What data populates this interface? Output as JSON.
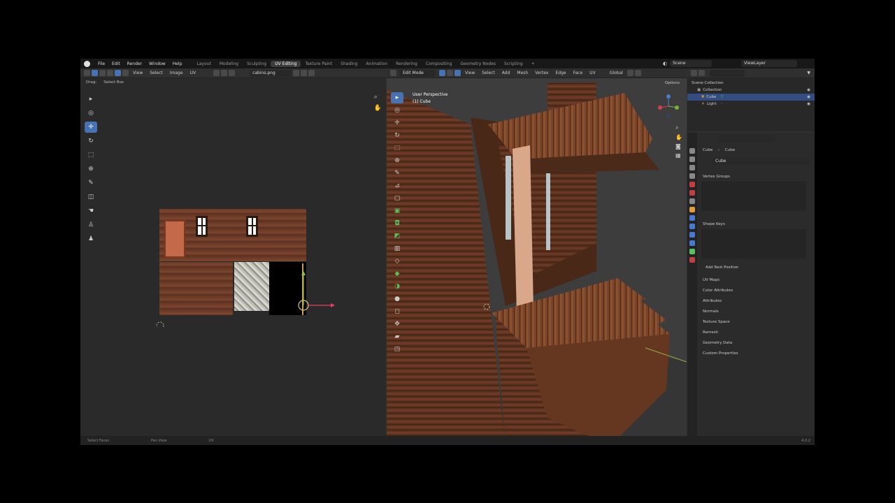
{
  "menu": [
    "File",
    "Edit",
    "Render",
    "Window",
    "Help"
  ],
  "workspaces": [
    {
      "label": "Layout",
      "active": false
    },
    {
      "label": "Modeling",
      "active": false
    },
    {
      "label": "Sculpting",
      "active": false
    },
    {
      "label": "UV Editing",
      "active": true
    },
    {
      "label": "Texture Paint",
      "active": false
    },
    {
      "label": "Shading",
      "active": false
    },
    {
      "label": "Animation",
      "active": false
    },
    {
      "label": "Rendering",
      "active": false
    },
    {
      "label": "Compositing",
      "active": false
    },
    {
      "label": "Geometry Nodes",
      "active": false
    },
    {
      "label": "Scripting",
      "active": false
    }
  ],
  "scene": "Scene",
  "view_layer": "ViewLayer",
  "uv_editor": {
    "header_menus": [
      "View",
      "Select",
      "Image",
      "UV"
    ],
    "image_name": "cabins.png",
    "sub_header": [
      "Drag:",
      "Select Box"
    ]
  },
  "viewport": {
    "mode": "Edit Mode",
    "header_menus": [
      "View",
      "Select",
      "Add",
      "Mesh",
      "Vertex",
      "Edge",
      "Face",
      "UV"
    ],
    "transform": "Global",
    "options": "Options",
    "perspective": "User Perspective",
    "object_label": "(1) Cube"
  },
  "outliner": {
    "title": "Scene Collection",
    "rows": [
      "Collection",
      "Cube",
      "Light"
    ]
  },
  "properties": {
    "breadcrumb": [
      "Cube",
      "Cube"
    ],
    "mesh_name": "Cube",
    "sections": {
      "vertex_groups": "Vertex Groups",
      "shape_keys": "Shape Keys",
      "add_rest_position": "Add Rest Position",
      "uv_maps": "UV Maps",
      "color_attributes": "Color Attributes",
      "attributes": "Attributes",
      "normals": "Normals",
      "texture_space": "Texture Space",
      "remesh": "Remesh",
      "geometry_data": "Geometry Data",
      "custom_properties": "Custom Properties"
    }
  },
  "status": {
    "left": "Select Faces",
    "middle": "Pan View",
    "right": "UV",
    "version": "4.0.2"
  },
  "colors": {
    "accent": "#4772b3",
    "selection": "#334d80",
    "bg": "#303030"
  }
}
